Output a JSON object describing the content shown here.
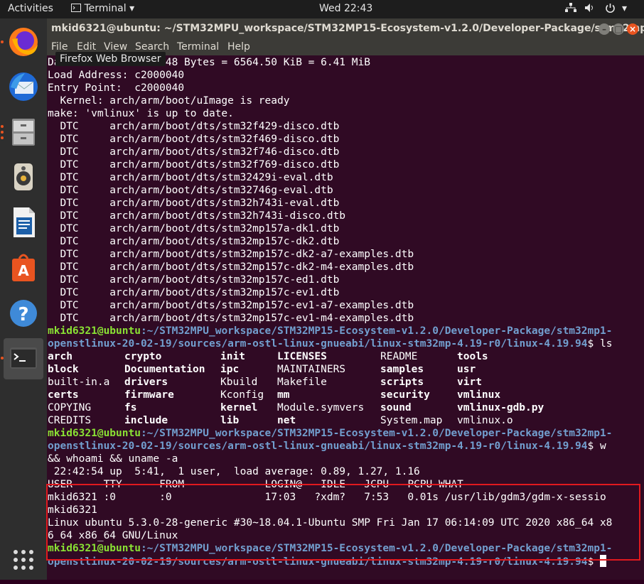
{
  "topbar": {
    "activities": "Activities",
    "app": "Terminal",
    "clock": "Wed 22:43"
  },
  "dock": {
    "items": [
      "firefox-icon",
      "thunderbird-icon",
      "files-icon",
      "rhythmbox-icon",
      "libreoffice-writer-icon",
      "ubuntu-software-icon",
      "help-icon",
      "terminal-icon"
    ],
    "apps_grid": "show-applications-icon"
  },
  "window": {
    "title": "mkid6321@ubuntu: ~/STM32MPU_workspace/STM32MP15-Ecosystem-v1.2.0/Developer-Package/stm32mp...",
    "menu": [
      "File",
      "Edit",
      "View",
      "Search",
      "Terminal",
      "Help"
    ],
    "tooltip": "Firefox Web Browser"
  },
  "terminal": {
    "output_top": [
      "Data Size:    6722048 Bytes = 6564.50 KiB = 6.41 MiB",
      "Load Address: c2000040",
      "Entry Point:  c2000040",
      "  Kernel: arch/arm/boot/uImage is ready",
      "make: 'vmlinux' is up to date.",
      "  DTC     arch/arm/boot/dts/stm32f429-disco.dtb",
      "  DTC     arch/arm/boot/dts/stm32f469-disco.dtb",
      "  DTC     arch/arm/boot/dts/stm32f746-disco.dtb",
      "  DTC     arch/arm/boot/dts/stm32f769-disco.dtb",
      "  DTC     arch/arm/boot/dts/stm32429i-eval.dtb",
      "  DTC     arch/arm/boot/dts/stm32746g-eval.dtb",
      "  DTC     arch/arm/boot/dts/stm32h743i-eval.dtb",
      "  DTC     arch/arm/boot/dts/stm32h743i-disco.dtb",
      "  DTC     arch/arm/boot/dts/stm32mp157a-dk1.dtb",
      "  DTC     arch/arm/boot/dts/stm32mp157c-dk2.dtb",
      "  DTC     arch/arm/boot/dts/stm32mp157c-dk2-a7-examples.dtb",
      "  DTC     arch/arm/boot/dts/stm32mp157c-dk2-m4-examples.dtb",
      "  DTC     arch/arm/boot/dts/stm32mp157c-ed1.dtb",
      "  DTC     arch/arm/boot/dts/stm32mp157c-ev1.dtb",
      "  DTC     arch/arm/boot/dts/stm32mp157c-ev1-a7-examples.dtb",
      "  DTC     arch/arm/boot/dts/stm32mp157c-ev1-m4-examples.dtb"
    ],
    "prompt_user": "mkid6321@ubuntu",
    "prompt_path_1": ":~/STM32MPU_workspace/STM32MP15-Ecosystem-v1.2.0/Developer-Package/stm32mp1-",
    "prompt_path_2": "openstlinux-20-02-19/sources/arm-ostl-linux-gnueabi/linux-stm32mp-4.19-r0/linux-4.19.94",
    "cmd1": "$ ls",
    "cmd2a": "$ w",
    "cmd2b": "&& whoami && uname -a",
    "cmd3": "$ ",
    "ls_rows": [
      [
        {
          "t": "arch",
          "k": "dir"
        },
        {
          "t": "crypto",
          "k": "dir"
        },
        {
          "t": "init",
          "k": "dir"
        },
        {
          "t": "LICENSES",
          "k": "dir"
        },
        {
          "t": "README",
          "k": "file"
        },
        {
          "t": "tools",
          "k": "dir"
        }
      ],
      [
        {
          "t": "block",
          "k": "dir"
        },
        {
          "t": "Documentation",
          "k": "dir"
        },
        {
          "t": "ipc",
          "k": "dir"
        },
        {
          "t": "MAINTAINERS",
          "k": "file"
        },
        {
          "t": "samples",
          "k": "dir"
        },
        {
          "t": "usr",
          "k": "dir"
        }
      ],
      [
        {
          "t": "built-in.a",
          "k": "file"
        },
        {
          "t": "drivers",
          "k": "dir"
        },
        {
          "t": "Kbuild",
          "k": "file"
        },
        {
          "t": "Makefile",
          "k": "file"
        },
        {
          "t": "scripts",
          "k": "dir"
        },
        {
          "t": "virt",
          "k": "dir"
        }
      ],
      [
        {
          "t": "certs",
          "k": "dir"
        },
        {
          "t": "firmware",
          "k": "dir"
        },
        {
          "t": "Kconfig",
          "k": "file"
        },
        {
          "t": "mm",
          "k": "dir"
        },
        {
          "t": "security",
          "k": "dir"
        },
        {
          "t": "vmlinux",
          "k": "exe"
        }
      ],
      [
        {
          "t": "COPYING",
          "k": "file"
        },
        {
          "t": "fs",
          "k": "dir"
        },
        {
          "t": "kernel",
          "k": "dir"
        },
        {
          "t": "Module.symvers",
          "k": "file"
        },
        {
          "t": "sound",
          "k": "dir"
        },
        {
          "t": "vmlinux-gdb.py",
          "k": "exe"
        }
      ],
      [
        {
          "t": "CREDITS",
          "k": "file"
        },
        {
          "t": "include",
          "k": "dir"
        },
        {
          "t": "lib",
          "k": "dir"
        },
        {
          "t": "net",
          "k": "dir"
        },
        {
          "t": "System.map",
          "k": "file"
        },
        {
          "t": "vmlinux.o",
          "k": "file"
        }
      ]
    ],
    "w_output": [
      " 22:42:54 up  5:41,  1 user,  load average: 0.89, 1.27, 1.16",
      "USER     TTY      FROM             LOGIN@   IDLE   JCPU   PCPU WHAT",
      "mkid6321 :0       :0               17:03   ?xdm?   7:53   0.01s /usr/lib/gdm3/gdm-x-sessio",
      "mkid6321",
      "Linux ubuntu 5.3.0-28-generic #30~18.04.1-Ubuntu SMP Fri Jan 17 06:14:09 UTC 2020 x86_64 x8",
      "6_64 x86_64 GNU/Linux"
    ],
    "colors": {
      "bg": "#300a24",
      "user": "#8ae234",
      "path": "#729fcf",
      "highlight": "#e0191e"
    }
  }
}
